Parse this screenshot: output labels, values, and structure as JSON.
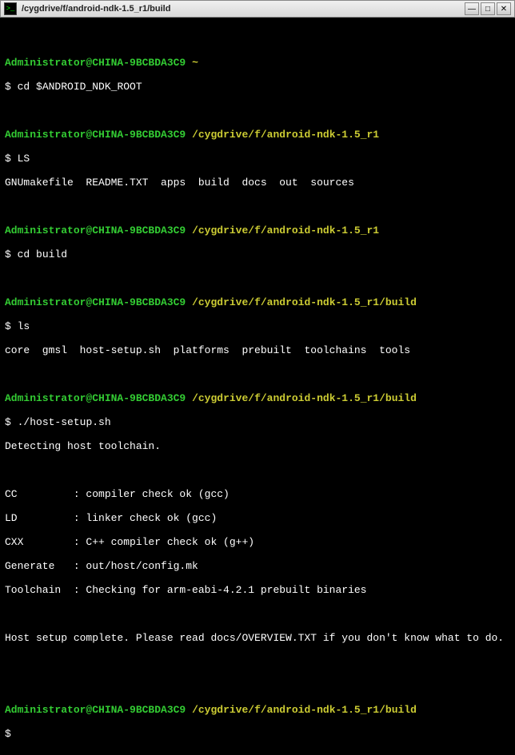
{
  "window": {
    "title": "/cygdrive/f/android-ndk-1.5_r1/build",
    "icon_glyph": ">_"
  },
  "user_host": "Administrator@CHINA-9BCBDA3C9",
  "home_path": "~",
  "path_root": "/cygdrive/f/android-ndk-1.5_r1",
  "path_build": "/cygdrive/f/android-ndk-1.5_r1/build",
  "prompt_char": "$",
  "cmd1": "cd $ANDROID_NDK_ROOT",
  "cmd2": "LS",
  "ls1_out": "GNUmakefile  README.TXT  apps  build  docs  out  sources",
  "cmd3": "cd build",
  "cmd4": "ls",
  "ls2_out": "core  gmsl  host-setup.sh  platforms  prebuilt  toolchains  tools",
  "cmd5": "./host-setup.sh",
  "hs_line1": "Detecting host toolchain.",
  "hs_cc": "CC         : compiler check ok (gcc)",
  "hs_ld": "LD         : linker check ok (gcc)",
  "hs_cxx": "CXX        : C++ compiler check ok (g++)",
  "hs_gen": "Generate   : out/host/config.mk",
  "hs_tc": "Toolchain  : Checking for arm-eabi-4.2.1 prebuilt binaries",
  "hs_done": "Host setup complete. Please read docs/OVERVIEW.TXT if you don't know what to do."
}
